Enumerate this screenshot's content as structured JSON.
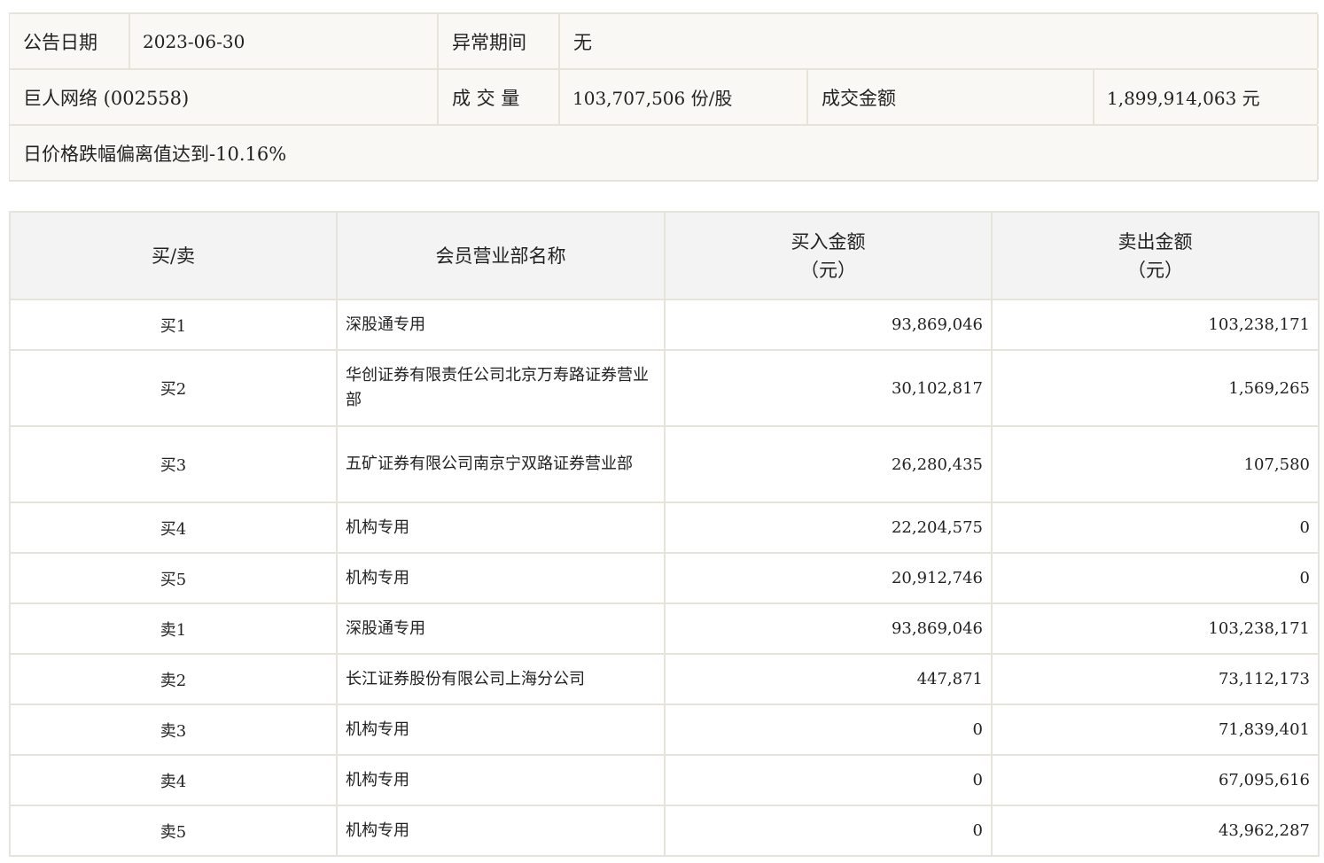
{
  "summary": {
    "announce_date_label": "公告日期",
    "announce_date_value": "2023-06-30",
    "abnormal_period_label": "异常期间",
    "abnormal_period_value": "无",
    "stock_name": "巨人网络 (002558)",
    "volume_label": "成 交 量",
    "volume_value": "103,707,506 份/股",
    "amount_label": "成交金额",
    "amount_value": "1,899,914,063 元",
    "reason": "日价格跌幅偏离值达到-10.16%"
  },
  "table": {
    "headers": {
      "side": "买/卖",
      "member": "会员营业部名称",
      "buy_line1": "买入金额",
      "buy_line2": "（元）",
      "sell_line1": "卖出金额",
      "sell_line2": "（元）"
    },
    "rows": [
      {
        "side": "买1",
        "name": "深股通专用",
        "buy": "93,869,046",
        "sell": "103,238,171"
      },
      {
        "side": "买2",
        "name": "华创证券有限责任公司北京万寿路证券营业部",
        "buy": "30,102,817",
        "sell": "1,569,265"
      },
      {
        "side": "买3",
        "name": "五矿证券有限公司南京宁双路证券营业部",
        "buy": "26,280,435",
        "sell": "107,580"
      },
      {
        "side": "买4",
        "name": "机构专用",
        "buy": "22,204,575",
        "sell": "0"
      },
      {
        "side": "买5",
        "name": "机构专用",
        "buy": "20,912,746",
        "sell": "0"
      },
      {
        "side": "卖1",
        "name": "深股通专用",
        "buy": "93,869,046",
        "sell": "103,238,171"
      },
      {
        "side": "卖2",
        "name": "长江证券股份有限公司上海分公司",
        "buy": "447,871",
        "sell": "73,112,173"
      },
      {
        "side": "卖3",
        "name": "机构专用",
        "buy": "0",
        "sell": "71,839,401"
      },
      {
        "side": "卖4",
        "name": "机构专用",
        "buy": "0",
        "sell": "67,095,616"
      },
      {
        "side": "卖5",
        "name": "机构专用",
        "buy": "0",
        "sell": "43,962,287"
      }
    ]
  }
}
